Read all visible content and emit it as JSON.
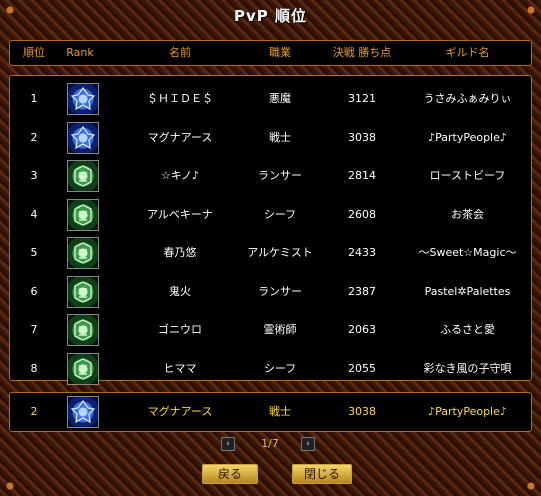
{
  "window": {
    "title": "PvP 順位"
  },
  "header": {
    "rank_no": "順位",
    "rank": "Rank",
    "name": "名前",
    "job": "職業",
    "points": "決戦 勝ち点",
    "guild": "ギルド名"
  },
  "rows": [
    {
      "no": "1",
      "icon": "blue-rank-emblem",
      "name": "＄ＨＩＤＥ＄",
      "job": "悪魔",
      "points": "3121",
      "guild": "うさみふぁみりぃ"
    },
    {
      "no": "2",
      "icon": "blue-rank-emblem",
      "name": "マグナアース",
      "job": "戦士",
      "points": "3038",
      "guild": "♪PartyPeople♪"
    },
    {
      "no": "3",
      "icon": "green-rank-emblem",
      "name": "☆キノ♪",
      "job": "ランサー",
      "points": "2814",
      "guild": "ローストビーフ"
    },
    {
      "no": "4",
      "icon": "green-rank-emblem",
      "name": "アルベキーナ",
      "job": "シーフ",
      "points": "2608",
      "guild": "お茶会"
    },
    {
      "no": "5",
      "icon": "green-rank-emblem",
      "name": "春乃悠",
      "job": "アルケミスト",
      "points": "2433",
      "guild": "～Sweet☆Magic～"
    },
    {
      "no": "6",
      "icon": "green-rank-emblem",
      "name": "鬼火",
      "job": "ランサー",
      "points": "2387",
      "guild": "Pastel✲Palettes"
    },
    {
      "no": "7",
      "icon": "green-rank-emblem",
      "name": "ゴニウロ",
      "job": "霊術師",
      "points": "2063",
      "guild": "ふるさと愛"
    },
    {
      "no": "8",
      "icon": "green-rank-emblem",
      "name": "ヒママ",
      "job": "シーフ",
      "points": "2055",
      "guild": "彩なき風の子守唄"
    }
  ],
  "self": {
    "no": "2",
    "icon": "blue-rank-emblem",
    "name": "マグナアース",
    "job": "戦士",
    "points": "3038",
    "guild": "♪PartyPeople♪"
  },
  "pager": {
    "prev": "‹",
    "text": "1/7",
    "next": "›"
  },
  "buttons": {
    "back": "戻る",
    "close": "閉じる"
  },
  "colors": {
    "accent": "#e89a2a",
    "border": "#b26a1c",
    "self_text": "#ffd83a",
    "button": "#f3d56a"
  }
}
